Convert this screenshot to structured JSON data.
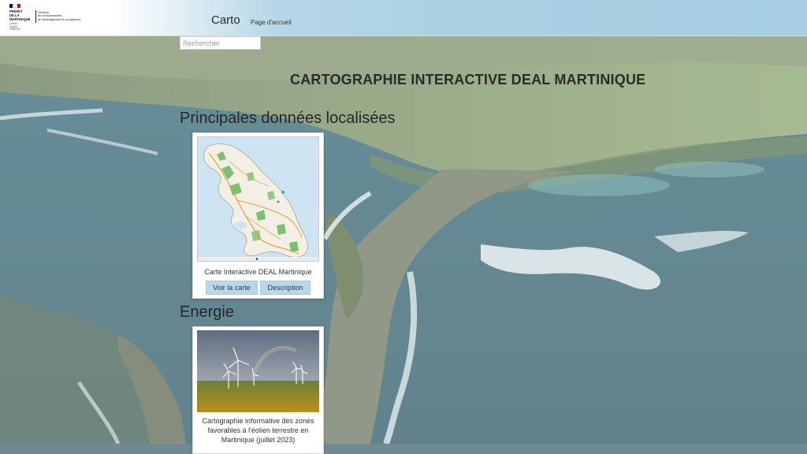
{
  "header": {
    "logo": {
      "line1": "PRÉFET",
      "line2": "DE LA",
      "line3": "MARTINIQUE",
      "motto": [
        "Liberté",
        "Égalité",
        "Fraternité"
      ],
      "direction": [
        "Direction",
        "de l'environnement,",
        "de l'aménagement et du logement"
      ]
    },
    "brand": "Carto",
    "home_link": "Page d'accueil"
  },
  "search": {
    "placeholder": "Rechercher",
    "value": ""
  },
  "page_title": "CARTOGRAPHIE INTERACTIVE DEAL MARTINIQUE",
  "sections": [
    {
      "title": "Principales données localisées",
      "cards": [
        {
          "caption": "Carte Interactive DEAL Martinique",
          "buttons": [
            "Voir la carte",
            "Description"
          ]
        }
      ]
    },
    {
      "title": "Energie",
      "cards": [
        {
          "caption": "Cartographie informative des zones favorables à l'éolien terrestre en Martinique (juillet 2023)"
        }
      ]
    }
  ],
  "colors": {
    "header_gradient_end": "#a6cde2",
    "button_bg": "#b9d7ea",
    "flag_blue": "#000091",
    "flag_red": "#e1000f"
  },
  "icons": [
    "map-thumbnail",
    "wind-turbine-photo"
  ]
}
